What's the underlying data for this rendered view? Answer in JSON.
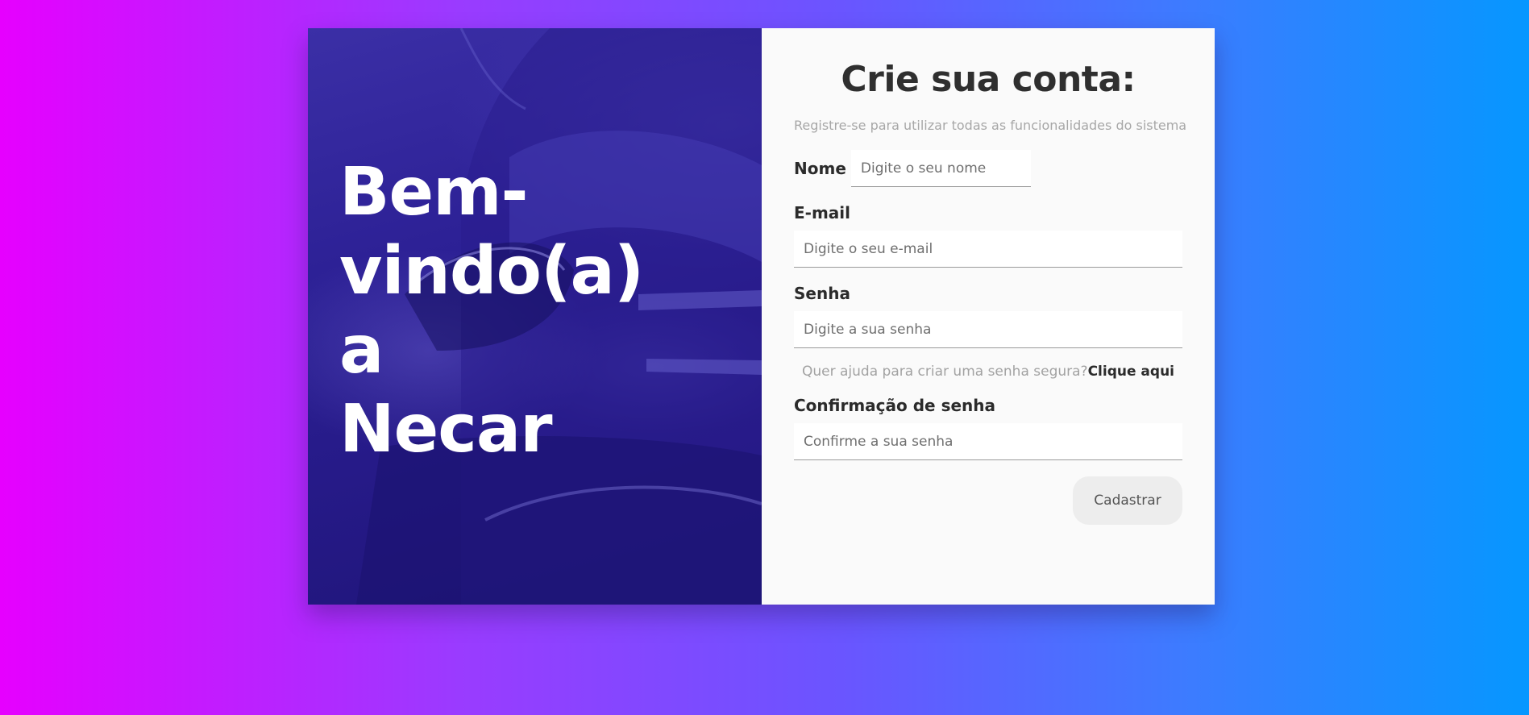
{
  "hero": {
    "title_lines": [
      "Bem-",
      "vindo(a)",
      "a",
      "Necar"
    ]
  },
  "form": {
    "title": "Crie sua conta:",
    "subtitle": "Registre-se para utilizar todas as funcionalidades do sistema",
    "name": {
      "label": "Nome",
      "placeholder": "Digite o seu nome"
    },
    "email": {
      "label": "E-mail",
      "placeholder": "Digite o seu e-mail"
    },
    "password": {
      "label": "Senha",
      "placeholder": "Digite a sua senha"
    },
    "help": {
      "text": "Quer ajuda para criar uma senha segura?",
      "link": "Clique aqui"
    },
    "confirm": {
      "label": "Confirmação de senha",
      "placeholder": "Confirme a sua senha"
    },
    "submit_label": "Cadastrar"
  },
  "colors": {
    "background_start": "#e600ff",
    "background_end": "#0697ff",
    "hero_overlay": "#2d2196",
    "panel": "#fafafa",
    "text_dark": "#2f2f2f",
    "text_muted": "#a7a7a7",
    "button_bg": "#ededed"
  }
}
